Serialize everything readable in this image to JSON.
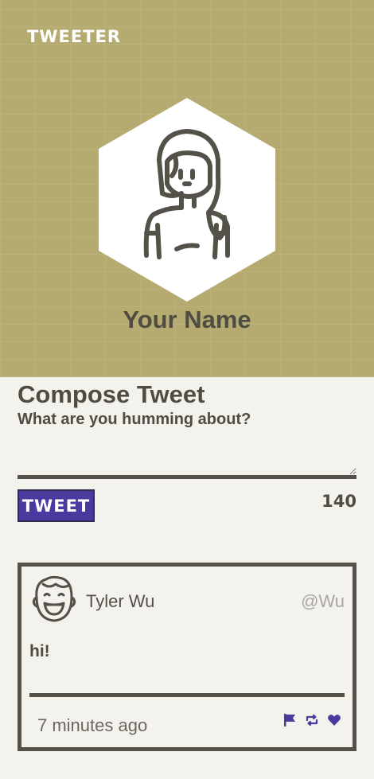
{
  "app": {
    "brand": "TWEETER"
  },
  "profile": {
    "name": "Your Name",
    "avatar_icon": "woman-avatar-icon"
  },
  "compose": {
    "title": "Compose Tweet",
    "placeholder": "What are you humming about?",
    "button_label": "TWEET",
    "counter": "140"
  },
  "tweets": [
    {
      "author": "Tyler Wu",
      "handle": "@Wu",
      "content": "hi!",
      "time": "7 minutes ago",
      "avatar_icon": "laughing-man-avatar-icon",
      "actions": [
        "flag-icon",
        "retweet-icon",
        "heart-icon"
      ]
    }
  ],
  "colors": {
    "header_bg": "#b5ab71",
    "page_bg": "#f4f2ed",
    "text": "#545149",
    "accent": "#4a3a9e"
  }
}
